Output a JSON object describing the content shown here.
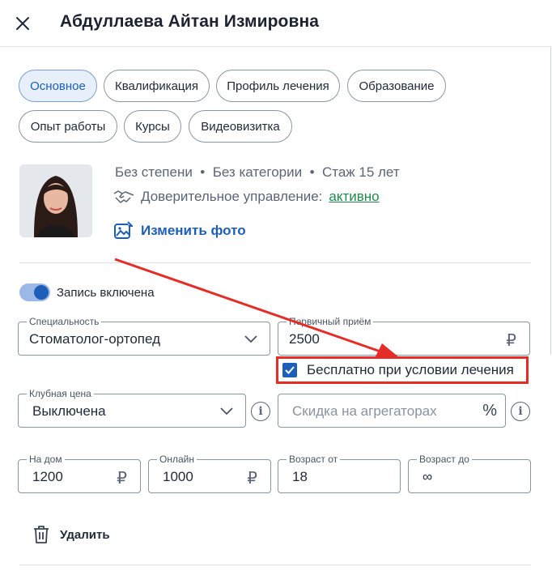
{
  "header": {
    "title": "Абдуллаева Айтан Измировна"
  },
  "tabs": [
    {
      "label": "Основное",
      "active": true
    },
    {
      "label": "Квалификация"
    },
    {
      "label": "Профиль лечения"
    },
    {
      "label": "Образование"
    },
    {
      "label": "Опыт работы"
    },
    {
      "label": "Курсы"
    },
    {
      "label": "Видеовизитка"
    }
  ],
  "profile": {
    "meta": "Без степени  •  Без категории  •  Стаж 15 лет",
    "trust_label": "Доверительное управление:",
    "trust_status": "активно",
    "change_photo": "Изменить фото"
  },
  "booking": {
    "label": "Запись включена",
    "enabled": true
  },
  "fields": {
    "specialty": {
      "label": "Специальность",
      "value": "Стоматолог-ортопед"
    },
    "primary": {
      "label": "Первичный приём",
      "value": "2500",
      "currency": "₽"
    },
    "free_checkbox": {
      "label": "Бесплатно при условии лечения",
      "checked": true
    },
    "club": {
      "label": "Клубная цена",
      "value": "Выключена"
    },
    "discount": {
      "placeholder": "Скидка на агрегаторах",
      "unit": "%"
    },
    "home": {
      "label": "На дом",
      "value": "1200",
      "currency": "₽"
    },
    "online": {
      "label": "Онлайн",
      "value": "1000",
      "currency": "₽"
    },
    "age_from": {
      "label": "Возраст от",
      "value": "18"
    },
    "age_to": {
      "label": "Возраст до",
      "value": "∞"
    }
  },
  "actions": {
    "delete": "Удалить"
  },
  "colors": {
    "accent": "#1d5fb8",
    "highlight": "#e52d27",
    "success": "#1f8a4a"
  }
}
